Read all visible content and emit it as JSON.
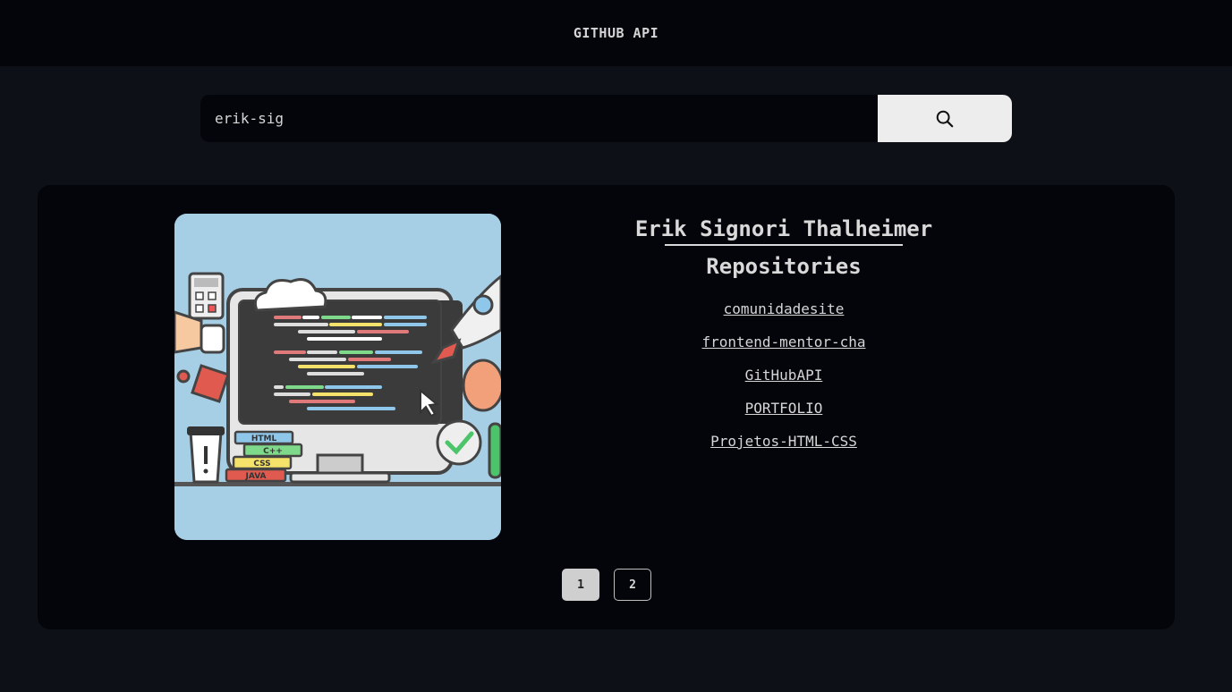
{
  "header": {
    "title": "GITHUB API"
  },
  "search": {
    "value": "erik-sig",
    "icon": "search-icon"
  },
  "profile": {
    "name": "Erik Signori Thalheimer",
    "repos_title": "Repositories",
    "repos": [
      "comunidadesite",
      "frontend-mentor-cha",
      "GitHubAPI",
      "PORTFOLIO",
      "Projetos-HTML-CSS"
    ],
    "avatar_labels": {
      "html": "HTML",
      "cpp": "C++",
      "css": "CSS",
      "java": "JAVA"
    }
  },
  "pagination": {
    "pages": [
      "1",
      "2"
    ],
    "current": "1"
  },
  "colors": {
    "page_bg": "#0d1017",
    "panel_bg": "#03050a",
    "button_bg": "#ededed",
    "text": "#d6d6d6",
    "avatar_bg": "#a6cfe6"
  }
}
